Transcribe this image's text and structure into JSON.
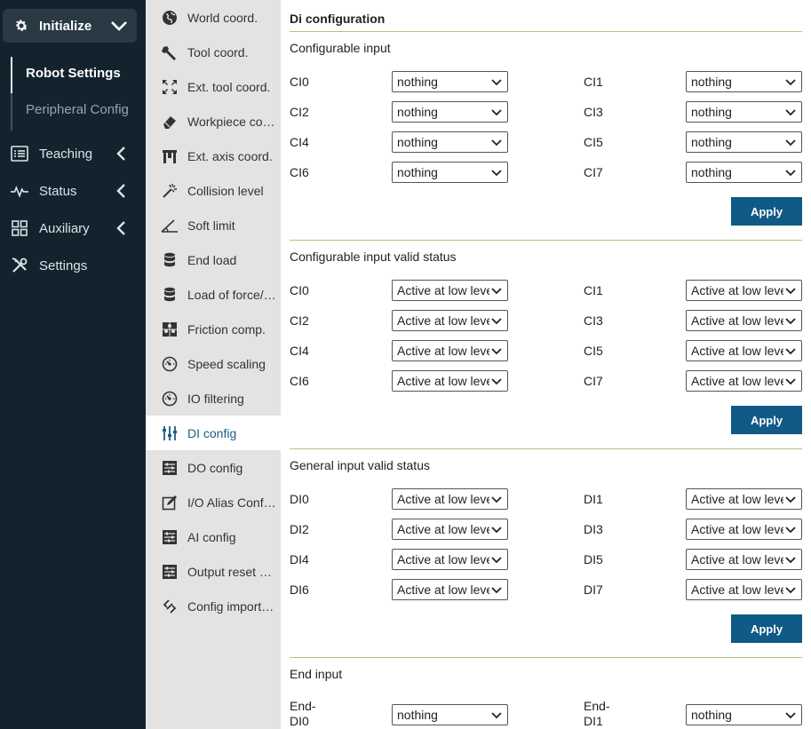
{
  "sidebar": {
    "main_item": {
      "label": "Initialize",
      "icon": "gear-icon"
    },
    "sub_items": [
      {
        "label": "Robot Settings",
        "active": true
      },
      {
        "label": "Peripheral Config",
        "active": false
      }
    ],
    "items": [
      {
        "label": "Teaching",
        "icon": "list-icon"
      },
      {
        "label": "Status",
        "icon": "pulse-icon"
      },
      {
        "label": "Auxiliary",
        "icon": "grid-icon"
      },
      {
        "label": "Settings",
        "icon": "tools-icon"
      }
    ]
  },
  "settings_list": [
    {
      "label": "World coord.",
      "icon": "globe-icon"
    },
    {
      "label": "Tool coord.",
      "icon": "wrench-icon"
    },
    {
      "label": "Ext. tool coord.",
      "icon": "expand-icon"
    },
    {
      "label": "Workpiece co…",
      "icon": "eraser-icon"
    },
    {
      "label": "Ext. axis coord.",
      "icon": "gantry-icon"
    },
    {
      "label": "Collision level",
      "icon": "wand-icon"
    },
    {
      "label": "Soft limit",
      "icon": "angle-icon"
    },
    {
      "label": "End load",
      "icon": "database-icon"
    },
    {
      "label": "Load of force/…",
      "icon": "database-icon"
    },
    {
      "label": "Friction comp.",
      "icon": "puzzle-icon"
    },
    {
      "label": "Speed scaling",
      "icon": "gauge-icon"
    },
    {
      "label": "IO filtering",
      "icon": "gauge-icon"
    },
    {
      "label": "DI config",
      "icon": "sliders-vertical-icon",
      "active": true
    },
    {
      "label": "DO config",
      "icon": "sliders-icon"
    },
    {
      "label": "I/O Alias Conf…",
      "icon": "edit-icon"
    },
    {
      "label": "AI config",
      "icon": "sliders-icon"
    },
    {
      "label": "Output reset …",
      "icon": "sliders-icon"
    },
    {
      "label": "Config import…",
      "icon": "link-icon"
    }
  ],
  "content": {
    "title": "Di configuration",
    "apply_label": "Apply",
    "sections": [
      {
        "title": "Configurable input",
        "fields": [
          {
            "label": "CI0",
            "value": "nothing"
          },
          {
            "label": "CI1",
            "value": "nothing"
          },
          {
            "label": "CI2",
            "value": "nothing"
          },
          {
            "label": "CI3",
            "value": "nothing"
          },
          {
            "label": "CI4",
            "value": "nothing"
          },
          {
            "label": "CI5",
            "value": "nothing"
          },
          {
            "label": "CI6",
            "value": "nothing"
          },
          {
            "label": "CI7",
            "value": "nothing"
          }
        ]
      },
      {
        "title": "Configurable input valid status",
        "fields": [
          {
            "label": "CI0",
            "value": "Active at low level"
          },
          {
            "label": "CI1",
            "value": "Active at low level"
          },
          {
            "label": "CI2",
            "value": "Active at low level"
          },
          {
            "label": "CI3",
            "value": "Active at low level"
          },
          {
            "label": "CI4",
            "value": "Active at low level"
          },
          {
            "label": "CI5",
            "value": "Active at low level"
          },
          {
            "label": "CI6",
            "value": "Active at low level"
          },
          {
            "label": "CI7",
            "value": "Active at low level"
          }
        ]
      },
      {
        "title": "General input valid status",
        "fields": [
          {
            "label": "DI0",
            "value": "Active at low level"
          },
          {
            "label": "DI1",
            "value": "Active at low level"
          },
          {
            "label": "DI2",
            "value": "Active at low level"
          },
          {
            "label": "DI3",
            "value": "Active at low level"
          },
          {
            "label": "DI4",
            "value": "Active at low level"
          },
          {
            "label": "DI5",
            "value": "Active at low level"
          },
          {
            "label": "DI6",
            "value": "Active at low level"
          },
          {
            "label": "DI7",
            "value": "Active at low level"
          }
        ]
      },
      {
        "title": "End input",
        "fields": [
          {
            "label": "End-DI0",
            "value": "nothing"
          },
          {
            "label": "End-DI1",
            "value": "nothing"
          }
        ]
      }
    ]
  },
  "colors": {
    "sidebar_bg": "#13232e",
    "accent": "#0f5a86",
    "divider": "#b3c57a",
    "list_bg": "#e3e3e3"
  }
}
